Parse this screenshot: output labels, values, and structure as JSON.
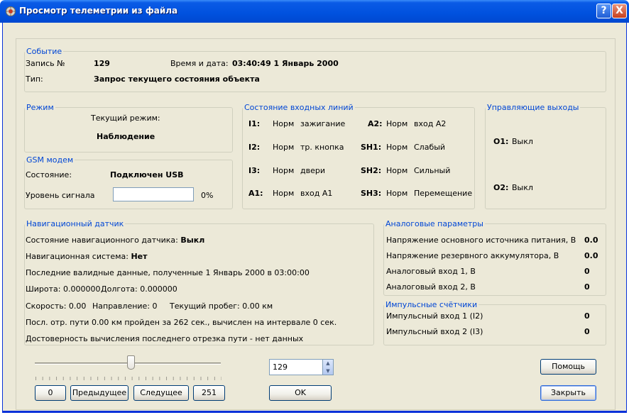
{
  "window": {
    "title": "Просмотр телеметрии из файла",
    "help_button": "?",
    "close_button": "X"
  },
  "event": {
    "legend": "Событие",
    "record_label": "Запись №",
    "record_value": "129",
    "datetime_label": "Время и дата:",
    "datetime_value": "03:40:49  1  Январь  2000",
    "type_label": "Тип:",
    "type_value": "Запрос текущего состояния объекта"
  },
  "mode": {
    "legend": "Режим",
    "current_label": "Текущий режим:",
    "current_value": "Наблюдение"
  },
  "gsm": {
    "legend": "GSM модем",
    "state_label": "Состояние:",
    "state_value": "Подключен USB",
    "signal_label": "Уровень сигнала",
    "signal_percent": "0%",
    "signal_level": 0
  },
  "inputs": {
    "legend": "Состояние входных линий",
    "lines": [
      {
        "id": "I1:",
        "state": "Норм",
        "name": "зажигание"
      },
      {
        "id": "I2:",
        "state": "Норм",
        "name": "тр. кнопка"
      },
      {
        "id": "I3:",
        "state": "Норм",
        "name": "двери"
      },
      {
        "id": "A1:",
        "state": "Норм",
        "name": "вход А1"
      },
      {
        "id": "A2:",
        "state": "Норм",
        "name": "вход А2"
      },
      {
        "id": "SH1:",
        "state": "Норм",
        "name": "Слабый"
      },
      {
        "id": "SH2:",
        "state": "Норм",
        "name": "Сильный"
      },
      {
        "id": "SH3:",
        "state": "Норм",
        "name": "Перемещение"
      }
    ]
  },
  "outputs": {
    "legend": "Управляющие выходы",
    "items": [
      {
        "id": "O1:",
        "state": "Выкл"
      },
      {
        "id": "O2:",
        "state": "Выкл"
      }
    ]
  },
  "nav": {
    "legend": "Навигационный датчик",
    "sensor_label": "Состояние навигационного датчика:",
    "sensor_value": "Выкл",
    "system_label": "Навигационная система:",
    "system_value": "Нет",
    "last_valid": "Последние валидные данные,  полученные 1  Январь  2000 в 03:00:00",
    "lat": "Широта: 0.000000",
    "lon": "Долгота: 0.000000",
    "speed": "Скорость: 0.00",
    "direction": "Направление: 0",
    "mileage": "Текущий пробег: 0.00 км",
    "segment": "Посл. отр. пути 0.00 км пройден за 262 сек., вычислен на интервале 0 сек.",
    "reliability": "Достоверность вычисления последнего отрезка пути - нет данных"
  },
  "analog": {
    "legend": "Аналоговые параметры",
    "rows": [
      {
        "label": "Напряжение основного источника питания, В",
        "value": "0.0"
      },
      {
        "label": "Напряжение резервного аккумулятора, В",
        "value": "0.0"
      },
      {
        "label": "Аналоговый вход 1, В",
        "value": "0"
      },
      {
        "label": "Аналоговый вход 2, В",
        "value": "0"
      }
    ]
  },
  "pulse": {
    "legend": "Импульсные счётчики",
    "rows": [
      {
        "label": "Импульсный вход 1 (I2)",
        "value": "0"
      },
      {
        "label": "Импульсный вход 2 (I3)",
        "value": "0"
      }
    ]
  },
  "navigation": {
    "slider_min": 0,
    "slider_max": 251,
    "slider_value": 129,
    "first_button": "0",
    "prev_button": "Предыдущее",
    "next_button": "Следущее",
    "last_button": "251",
    "record_input": "129",
    "ok_button": "OK"
  },
  "actions": {
    "help_button": "Помощь",
    "close_button": "Закрыть"
  }
}
